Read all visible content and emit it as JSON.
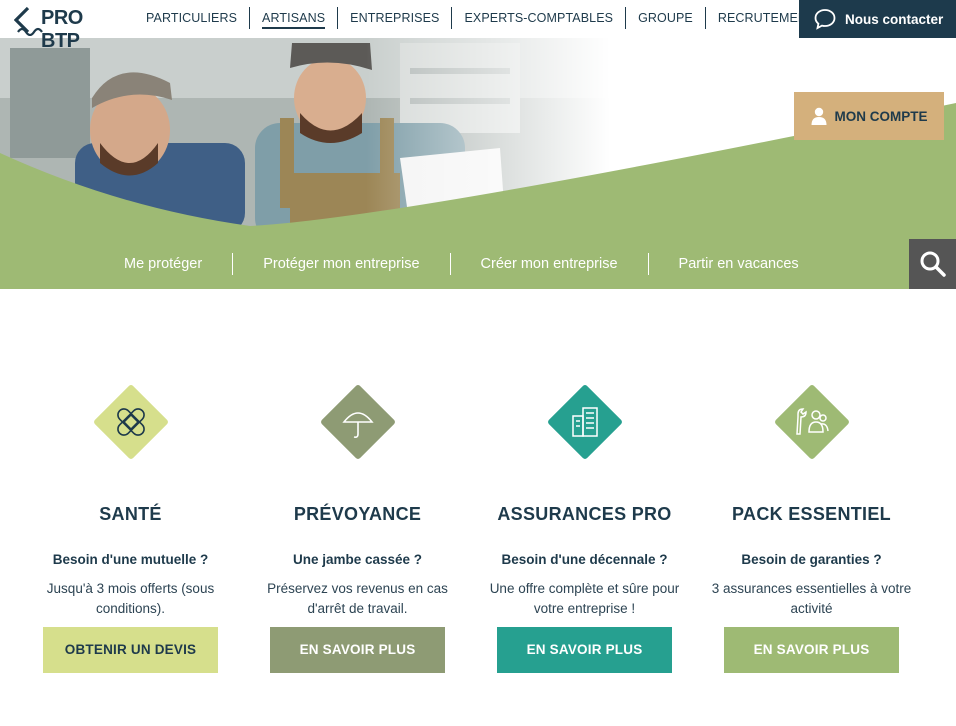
{
  "brand": {
    "logo_text": "PRO BTP"
  },
  "nav": {
    "items": [
      {
        "label": "PARTICULIERS",
        "active": false
      },
      {
        "label": "ARTISANS",
        "active": true
      },
      {
        "label": "ENTREPRISES",
        "active": false
      },
      {
        "label": "EXPERTS-COMPTABLES",
        "active": false
      },
      {
        "label": "GROUPE",
        "active": false
      },
      {
        "label": "RECRUTEMENT",
        "active": false
      }
    ],
    "contact_label": "Nous contacter"
  },
  "hero": {
    "account_label": "MON COMPTE",
    "subnav": [
      "Me protéger",
      "Protéger mon entreprise",
      "Créer mon entreprise",
      "Partir en vacances"
    ],
    "search_icon": "search-icon"
  },
  "colors": {
    "navy": "#1d3a4c",
    "hero_green": "#9eba74",
    "account_gold": "#d4b07c",
    "search_grey": "#555555",
    "sante": "#d6df8c",
    "prevoyance": "#8e9b74",
    "assurances_pro": "#26a090",
    "pack": "#9eba74"
  },
  "cards": [
    {
      "icon": "bandage-icon",
      "title": "SANTÉ",
      "subtitle": "Besoin d'une mutuelle ?",
      "desc": "Jusqu'à 3 mois offerts (sous conditions).",
      "cta": "OBTENIR UN DEVIS"
    },
    {
      "icon": "umbrella-icon",
      "title": "PRÉVOYANCE",
      "subtitle": "Une jambe cassée ?",
      "desc": "Préservez vos revenus en cas d'arrêt de travail.",
      "cta": "EN SAVOIR PLUS"
    },
    {
      "icon": "building-icon",
      "title": "ASSURANCES PRO",
      "subtitle": "Besoin d'une décennale ?",
      "desc": "Une offre complète et sûre pour votre entreprise !",
      "cta": "EN SAVOIR PLUS"
    },
    {
      "icon": "tools-people-icon",
      "title": "PACK ESSENTIEL",
      "subtitle": "Besoin de garanties ?",
      "desc": "3 assurances essentielles à votre activité",
      "cta": "EN SAVOIR PLUS"
    }
  ]
}
